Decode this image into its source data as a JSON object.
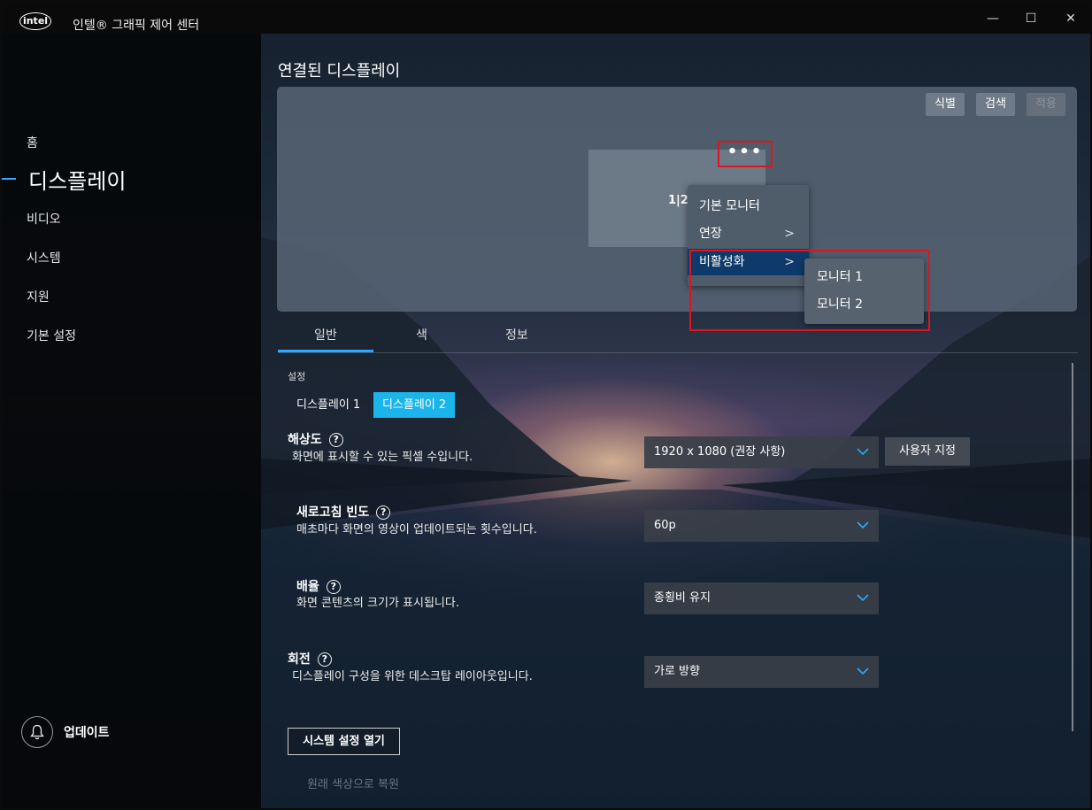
{
  "app": {
    "logo_text": "intel",
    "title": "인텔® 그래픽 제어 센터",
    "window_controls": {
      "minimize": "—",
      "maximize": "☐",
      "close": "✕"
    }
  },
  "sidebar": {
    "items": [
      {
        "label": "홈",
        "active": false
      },
      {
        "label": "디스플레이",
        "active": true
      },
      {
        "label": "비디오",
        "active": false
      },
      {
        "label": "시스템",
        "active": false
      },
      {
        "label": "지원",
        "active": false
      },
      {
        "label": "기본 설정",
        "active": false
      }
    ],
    "update_label": "업데이트"
  },
  "main": {
    "section_title": "연결된 디스플레이",
    "toolbar": {
      "identify": "식별",
      "detect": "검색",
      "apply": "적용"
    },
    "monitor_label": "1|2",
    "more_button": "•••",
    "context_menu": {
      "items": [
        {
          "label": "기본 모니터",
          "has_submenu": false,
          "highlighted": false
        },
        {
          "label": "연장",
          "has_submenu": true,
          "highlighted": false
        },
        {
          "label": "비활성화",
          "has_submenu": true,
          "highlighted": true
        }
      ],
      "submenu": [
        "모니터 1",
        "모니터 2"
      ]
    },
    "tabs": [
      {
        "label": "일반",
        "active": true
      },
      {
        "label": "색",
        "active": false
      },
      {
        "label": "정보",
        "active": false
      }
    ],
    "settings_label": "설정",
    "display_buttons": [
      {
        "label": "디스플레이 1",
        "selected": false
      },
      {
        "label": "디스플레이 2",
        "selected": true
      }
    ],
    "settings": {
      "resolution": {
        "title": "해상도",
        "desc": "화면에 표시할 수 있는 픽셀 수입니다.",
        "value": "1920 x 1080 (권장 사항)",
        "custom_button": "사용자 지정"
      },
      "refresh": {
        "title": "새로고침 빈도",
        "desc": "매초마다 화면의 영상이 업데이트되는 횟수입니다.",
        "value": "60p"
      },
      "scaling": {
        "title": "배율",
        "desc": "화면 콘텐츠의 크기가 표시됩니다.",
        "value": "종횡비 유지"
      },
      "rotation": {
        "title": "회전",
        "desc": "디스플레이 구성을 위한 데스크탑 레이아웃입니다.",
        "value": "가로 방향"
      }
    },
    "help_glyph": "?",
    "open_system_settings": "시스템 설정 열기",
    "restore_colors": "원래 색상으로 복원"
  },
  "colors": {
    "accent": "#29a9ff",
    "selected_display": "#1bb5ec",
    "annotation_red": "#e0141c",
    "menu_highlight": "#0d3a6a"
  }
}
